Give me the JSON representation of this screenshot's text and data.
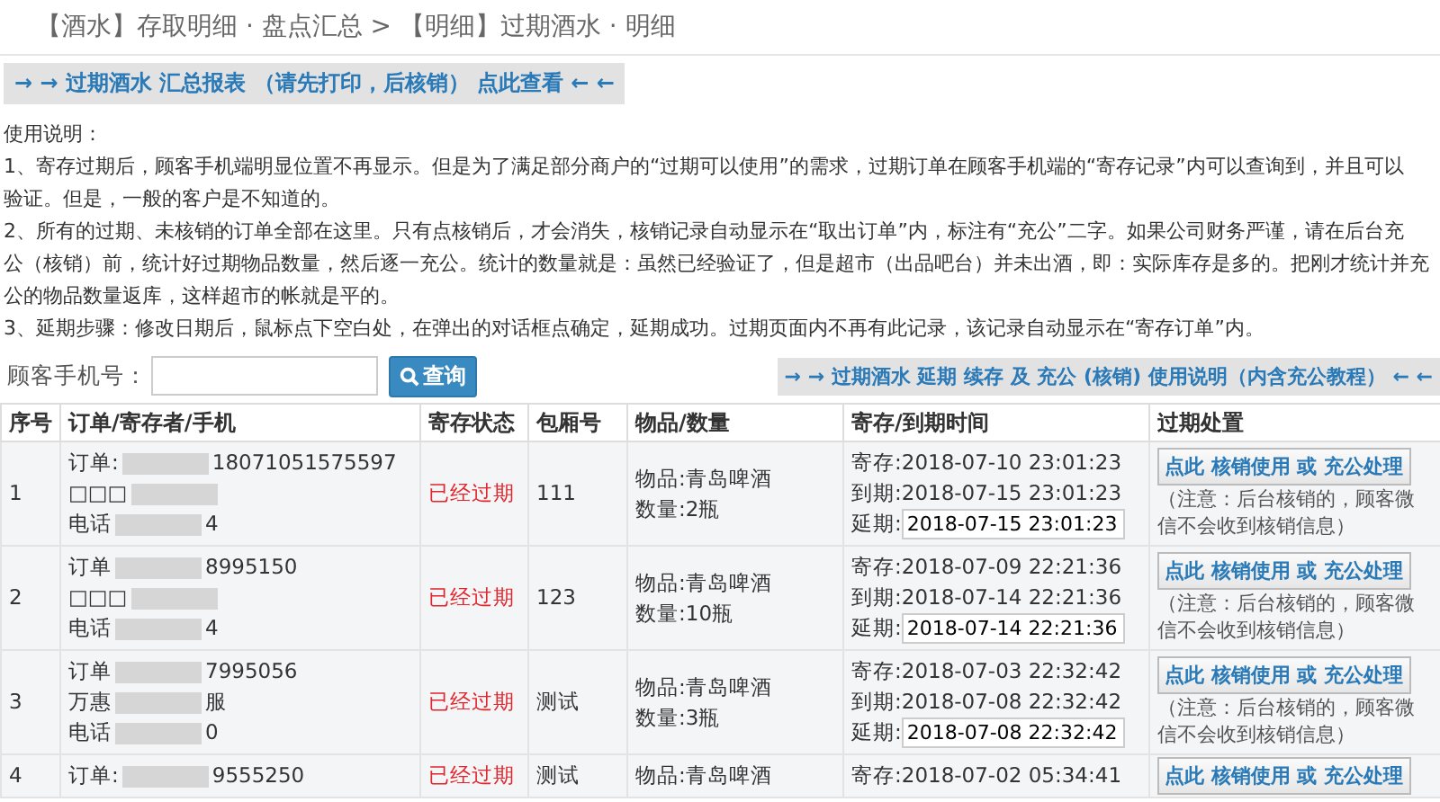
{
  "breadcrumb": "【酒水】存取明细 · 盘点汇总 > 【明细】过期酒水 · 明细",
  "report_link": "→ → 过期酒水 汇总报表 （请先打印，后核销） 点此查看 ← ←",
  "instructions": {
    "title": "使用说明：",
    "lines": [
      "1、寄存过期后，顾客手机端明显位置不再显示。但是为了满足部分商户的“过期可以使用”的需求，过期订单在顾客手机端的“寄存记录”内可以查询到，并且可以",
      "验证。但是，一般的客户是不知道的。",
      "2、所有的过期、未核销的订单全部在这里。只有点核销后，才会消失，核销记录自动显示在“取出订单”内，标注有“充公”二字。如果公司财务严谨，请在后台充",
      "公（核销）前，统计好过期物品数量，然后逐一充公。统计的数量就是：虽然已经验证了，但是超市（出品吧台）并未出酒，即：实际库存是多的。把刚才统计并充",
      "公的物品数量返库，这样超市的帐就是平的。",
      "3、延期步骤：修改日期后，鼠标点下空白处，在弹出的对话框点确定，延期成功。过期页面内不再有此记录，该记录自动显示在“寄存订单”内。"
    ]
  },
  "search": {
    "label": "顾客手机号：",
    "button": "查询"
  },
  "help_link": "→ → 过期酒水 延期 续存 及 充公 (核销) 使用说明（内含充公教程） ← ←",
  "table": {
    "columns": [
      "序号",
      "订单/寄存者/手机",
      "寄存状态",
      "包厢号",
      "物品/数量",
      "寄存/到期时间",
      "过期处置"
    ],
    "rows": [
      {
        "index": "1",
        "order_label": "订单:",
        "order_tail": "18071051575597",
        "name_head": "□□□",
        "name_tail": "",
        "phone_label": "电话",
        "phone_tail": "4",
        "status": "已经过期",
        "expired": true,
        "room": "111",
        "goods": "物品:青岛啤酒",
        "qty": "数量:2瓶",
        "deposit": "寄存:2018-07-10 23:01:23",
        "expire": "到期:2018-07-15 23:01:23",
        "extend_label": "延期:",
        "extend_value": "2018-07-15 23:01:23",
        "action": "点此 核销使用 或 充公处理",
        "note": "（注意：后台核销的，顾客微信不会收到核销信息）"
      },
      {
        "index": "2",
        "order_label": "订单",
        "order_tail": "8995150",
        "name_head": "□□□",
        "name_tail": "",
        "phone_label": "电话",
        "phone_tail": "4",
        "status": "已经过期",
        "expired": true,
        "room": "123",
        "goods": "物品:青岛啤酒",
        "qty": "数量:10瓶",
        "deposit": "寄存:2018-07-09 22:21:36",
        "expire": "到期:2018-07-14 22:21:36",
        "extend_label": "延期:",
        "extend_value": "2018-07-14 22:21:36",
        "action": "点此 核销使用 或 充公处理",
        "note": "（注意：后台核销的，顾客微信不会收到核销信息）"
      },
      {
        "index": "3",
        "order_label": "订单",
        "order_tail": "7995056",
        "name_head": "万惠",
        "name_tail": "服",
        "phone_label": "电话",
        "phone_tail": "0",
        "status": "已经过期",
        "expired": true,
        "room": "测试",
        "goods": "物品:青岛啤酒",
        "qty": "数量:3瓶",
        "deposit": "寄存:2018-07-03 22:32:42",
        "expire": "到期:2018-07-08 22:32:42",
        "extend_label": "延期:",
        "extend_value": "2018-07-08 22:32:42",
        "action": "点此 核销使用 或 充公处理",
        "note": "（注意：后台核销的，顾客微信不会收到核销信息）"
      },
      {
        "index": "4",
        "order_label": "订单:",
        "order_tail": "9555250",
        "status": "已经过期",
        "expired": true,
        "room": "测试",
        "goods": "物品:青岛啤酒",
        "deposit": "寄存:2018-07-02 05:34:41",
        "action": "点此 核销使用 或 充公处理"
      }
    ]
  }
}
